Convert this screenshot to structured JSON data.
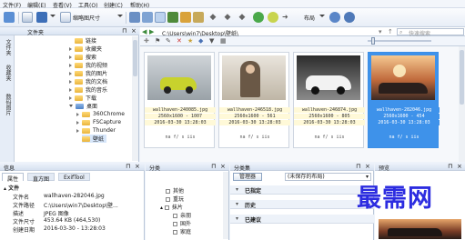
{
  "menu": [
    "文件(F)",
    "编辑(E)",
    "查看(V)",
    "工具(O)",
    "创建(C)",
    "帮助(H)"
  ],
  "toolbar": {
    "thumb_size_label": "缩略图尺寸",
    "layout_label": "布局"
  },
  "folders_panel": {
    "title": "文件夹",
    "vertical_tabs": [
      "文件夹",
      "收藏夹",
      "数码图片"
    ],
    "items": [
      "链接",
      "收藏夹",
      "搜索",
      "我的视频",
      "我的图片",
      "我的文档",
      "我的音乐",
      "下载",
      "桌面",
      "360Chrome",
      "FSCapture",
      "Thunder",
      "壁纸"
    ]
  },
  "address": {
    "path": "C:\\Users\\win7\\Desktop\\壁纸\\",
    "search_placeholder": "快速搜索"
  },
  "thumbnails": [
    {
      "name": "wallhaven-240085.jpg",
      "dims": "2560x1600 - 1007",
      "date": "2016-03-30 13:28:03",
      "meta": "na f/ s iis",
      "selected": false
    },
    {
      "name": "wallhaven-246518.jpg",
      "dims": "2560x1600 - 561",
      "date": "2016-03-30 13:28:03",
      "meta": "na f/ s iis",
      "selected": false
    },
    {
      "name": "wallhaven-246874.jpg",
      "dims": "2560x1600 - 805",
      "date": "2016-03-30 13:28:03",
      "meta": "na f/ s iis",
      "selected": false
    },
    {
      "name": "wallhaven-282046.jpg",
      "dims": "2560x1600 - 454",
      "date": "2016-03-30 13:28:03",
      "meta": "na f/ s iis",
      "selected": true
    }
  ],
  "info_panel": {
    "title": "信息",
    "tabs": [
      "属性",
      "直方图",
      "ExifTool"
    ],
    "section": "文件",
    "rows": [
      {
        "label": "文件名",
        "value": "wallhaven-282046.jpg"
      },
      {
        "label": "文件路径",
        "value": "C:\\Users\\win7\\Desktop\\壁..."
      },
      {
        "label": "描述",
        "value": "JPEG 图像"
      },
      {
        "label": "文件尺寸",
        "value": "453.64 KB (464,530)"
      },
      {
        "label": "创建日期",
        "value": "2016-03-30 - 13:28:03"
      }
    ]
  },
  "category_panel": {
    "title": "分类",
    "items": [
      "其他",
      "重玩",
      "抹片",
      "亲朋",
      "国外",
      "家庭"
    ]
  },
  "catset_panel": {
    "title": "分类集",
    "manage": "管理器",
    "dropdown": "(未保存的布局)",
    "groups": [
      "已指定",
      "历史",
      "已建议"
    ]
  },
  "preview_panel": {
    "title": "预览"
  },
  "watermark": "最需网",
  "colors": {
    "accent": "#3e92ea",
    "panel_bg": "#eef3fa"
  }
}
